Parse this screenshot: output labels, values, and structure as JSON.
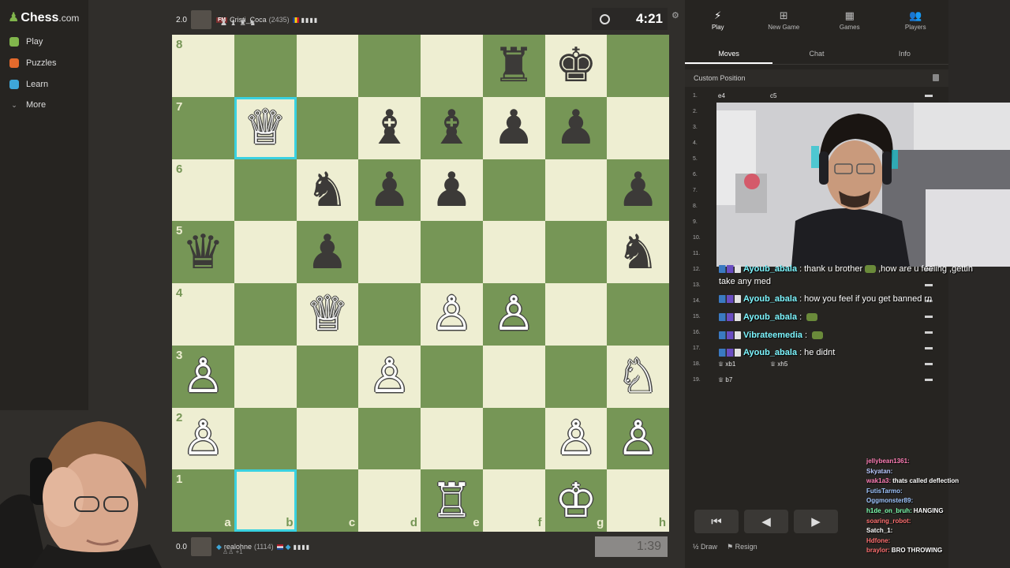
{
  "sidebar": {
    "logo_text": "Chess",
    "logo_suffix": ".com",
    "items": [
      {
        "label": "Play",
        "icon": "play-icon",
        "color": "#81b64c"
      },
      {
        "label": "Puzzles",
        "icon": "puzzle-icon",
        "color": "#e46a2c"
      },
      {
        "label": "Learn",
        "icon": "learn-icon",
        "color": "#3ea6d8"
      },
      {
        "label": "More",
        "icon": "chevron-down-icon",
        "color": "#aaaaaa"
      }
    ]
  },
  "top_player": {
    "score": "2.0",
    "title": "FM",
    "name": "Cristi_Coca",
    "rating": "(2435)",
    "captured": "♟ ♝ ♜ ♞"
  },
  "bottom_player": {
    "score": "0.0",
    "name": "realohne",
    "rating": "(1114)",
    "captured_diff": "+1"
  },
  "clocks": {
    "top": "4:21",
    "bottom": "1:39"
  },
  "board": {
    "light_color": "#eeeed2",
    "dark_color": "#769656",
    "highlight_color": "#3ad1e0",
    "ranks": [
      "8",
      "7",
      "6",
      "5",
      "4",
      "3",
      "2",
      "1"
    ],
    "files": [
      "a",
      "b",
      "c",
      "d",
      "e",
      "f",
      "g",
      "h"
    ],
    "pieces": [
      [
        "",
        "",
        "",
        "",
        "",
        "♜",
        "♚",
        ""
      ],
      [
        "",
        "♕",
        "",
        "♝",
        "♝",
        "♟",
        "♟",
        ""
      ],
      [
        "",
        "",
        "♞",
        "♟",
        "♟",
        "",
        "",
        "♟"
      ],
      [
        "♛",
        "",
        "♟",
        "",
        "",
        "",
        "",
        "♞"
      ],
      [
        "",
        "",
        "♕",
        "",
        "♙",
        "♙",
        "",
        ""
      ],
      [
        "♙",
        "",
        "",
        "♙",
        "",
        "",
        "",
        "♘"
      ],
      [
        "♙",
        "",
        "",
        "",
        "",
        "",
        "♙",
        "♙"
      ],
      [
        "",
        "",
        "",
        "",
        "♖",
        "",
        "♔",
        ""
      ]
    ],
    "highlighted_squares": [
      "b7",
      "b1"
    ]
  },
  "panel": {
    "top_tabs": [
      {
        "label": "Play",
        "icon": "lightning-icon",
        "active": true
      },
      {
        "label": "New Game",
        "icon": "plus-icon",
        "active": false
      },
      {
        "label": "Games",
        "icon": "grid-icon",
        "active": false
      },
      {
        "label": "Players",
        "icon": "players-icon",
        "active": false
      }
    ],
    "sub_tabs": [
      {
        "label": "Moves",
        "active": true
      },
      {
        "label": "Chat",
        "active": false
      },
      {
        "label": "Info",
        "active": false
      }
    ],
    "custom_position": "Custom Position",
    "moves": [
      {
        "no": "1.",
        "white": "e4",
        "black": "c5"
      },
      {
        "no": "2.",
        "white": "",
        "black": ""
      },
      {
        "no": "3.",
        "white": "",
        "black": ""
      },
      {
        "no": "4.",
        "white": "",
        "black": ""
      },
      {
        "no": "5.",
        "white": "",
        "black": ""
      },
      {
        "no": "6.",
        "white": "",
        "black": ""
      },
      {
        "no": "7.",
        "white": "",
        "black": ""
      },
      {
        "no": "8.",
        "white": "",
        "black": ""
      },
      {
        "no": "9.",
        "white": "",
        "black": ""
      },
      {
        "no": "10.",
        "white": "",
        "black": ""
      },
      {
        "no": "11.",
        "white": "",
        "black": ""
      },
      {
        "no": "12.",
        "white": "",
        "black": ""
      },
      {
        "no": "13.",
        "white": "",
        "black": ""
      },
      {
        "no": "14.",
        "white": "",
        "black": ""
      },
      {
        "no": "15.",
        "white": "",
        "black": ""
      },
      {
        "no": "16.",
        "white": "",
        "black": ""
      },
      {
        "no": "17.",
        "white": "",
        "black": ""
      },
      {
        "no": "18.",
        "white": "♕ xb1",
        "black": "♕ xh5"
      },
      {
        "no": "19.",
        "white": "♕ b7",
        "black": ""
      }
    ],
    "controls": [
      "⏮",
      "◀",
      "▶"
    ],
    "draw_label": "Draw",
    "resign_label": "Resign"
  },
  "overlay_chat": [
    {
      "user": "Ayoub_abala",
      "sep": ":",
      "text": "thank u brother",
      "text2": ",how are u feeling ,gettin"
    },
    {
      "user": "",
      "sep": "",
      "text": "take any med",
      "text2": ""
    },
    {
      "user": "Ayoub_abala",
      "sep": ":",
      "text": "how you feel if you get banned rn",
      "text2": ""
    },
    {
      "user": "Ayoub_abala",
      "sep": ":",
      "text": "",
      "text2": ""
    },
    {
      "user": "Vibrateemedia",
      "sep": ":",
      "text": "",
      "text2": ""
    },
    {
      "user": "Ayoub_abala",
      "sep": ":",
      "text": "he didnt",
      "text2": ""
    }
  ],
  "twitch_chat": [
    {
      "user": "jellybean1361:",
      "text": "",
      "color": "#ff7eb6"
    },
    {
      "user": "Skyatan:",
      "text": "",
      "color": "#b8c8ff"
    },
    {
      "user": "wak1a3:",
      "text": "thats called deflection",
      "color": "#ff7eb6"
    },
    {
      "user": "FutisTarmo:",
      "text": "",
      "color": "#9fc6ff"
    },
    {
      "user": "Oggmonster89:",
      "text": "",
      "color": "#9fc6ff"
    },
    {
      "user": "h1de_on_bruh:",
      "text": "HANGING",
      "color": "#7dffb0"
    },
    {
      "user": "soaring_robot:",
      "text": "",
      "color": "#ff7070"
    },
    {
      "user": "Satch_1:",
      "text": "",
      "color": "#ffffff"
    },
    {
      "user": "Hdfone:",
      "text": "",
      "color": "#ff7070"
    },
    {
      "user": "braylor:",
      "text": "BRO THROWING",
      "color": "#ff7070"
    }
  ]
}
